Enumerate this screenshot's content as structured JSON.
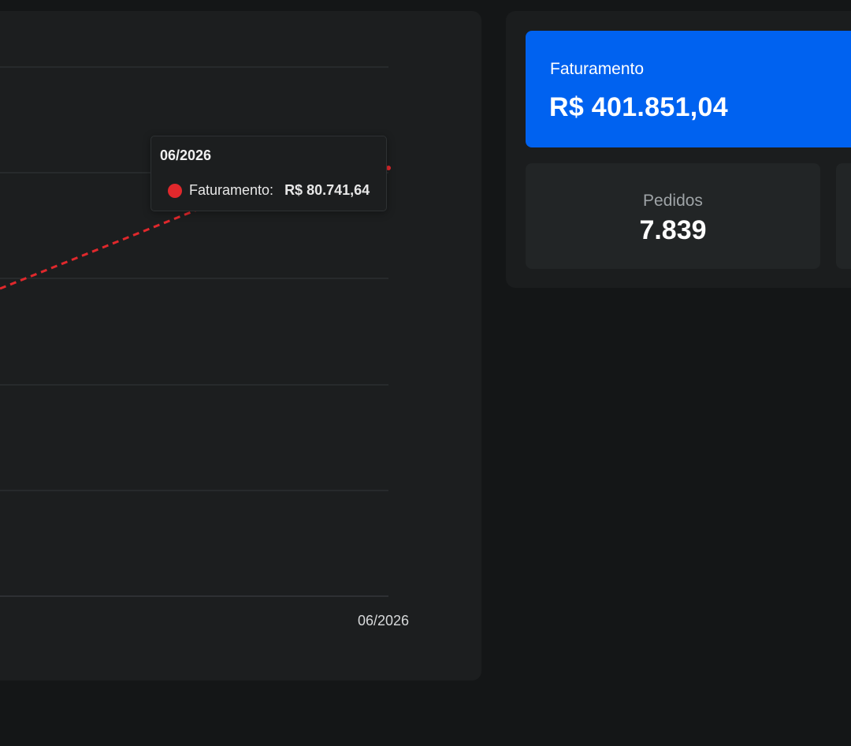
{
  "colors": {
    "accent_blue": "#0062f0",
    "series_red": "#e0282c"
  },
  "chart_data": {
    "type": "line",
    "x": [
      "06/2026"
    ],
    "series": [
      {
        "name": "Faturamento",
        "style": "dashed",
        "color": "#e0282c",
        "values": [
          80741.64
        ]
      }
    ],
    "grid": true,
    "tooltip": {
      "title": "06/2026",
      "series_label": "Faturamento:",
      "value": "R$ 80.741,64"
    }
  },
  "chart": {
    "x_tick_label": "06/2026"
  },
  "kpis": {
    "revenue": {
      "label": "Faturamento",
      "value": "R$ 401.851,04"
    },
    "orders": {
      "label": "Pedidos",
      "value": "7.839"
    }
  }
}
